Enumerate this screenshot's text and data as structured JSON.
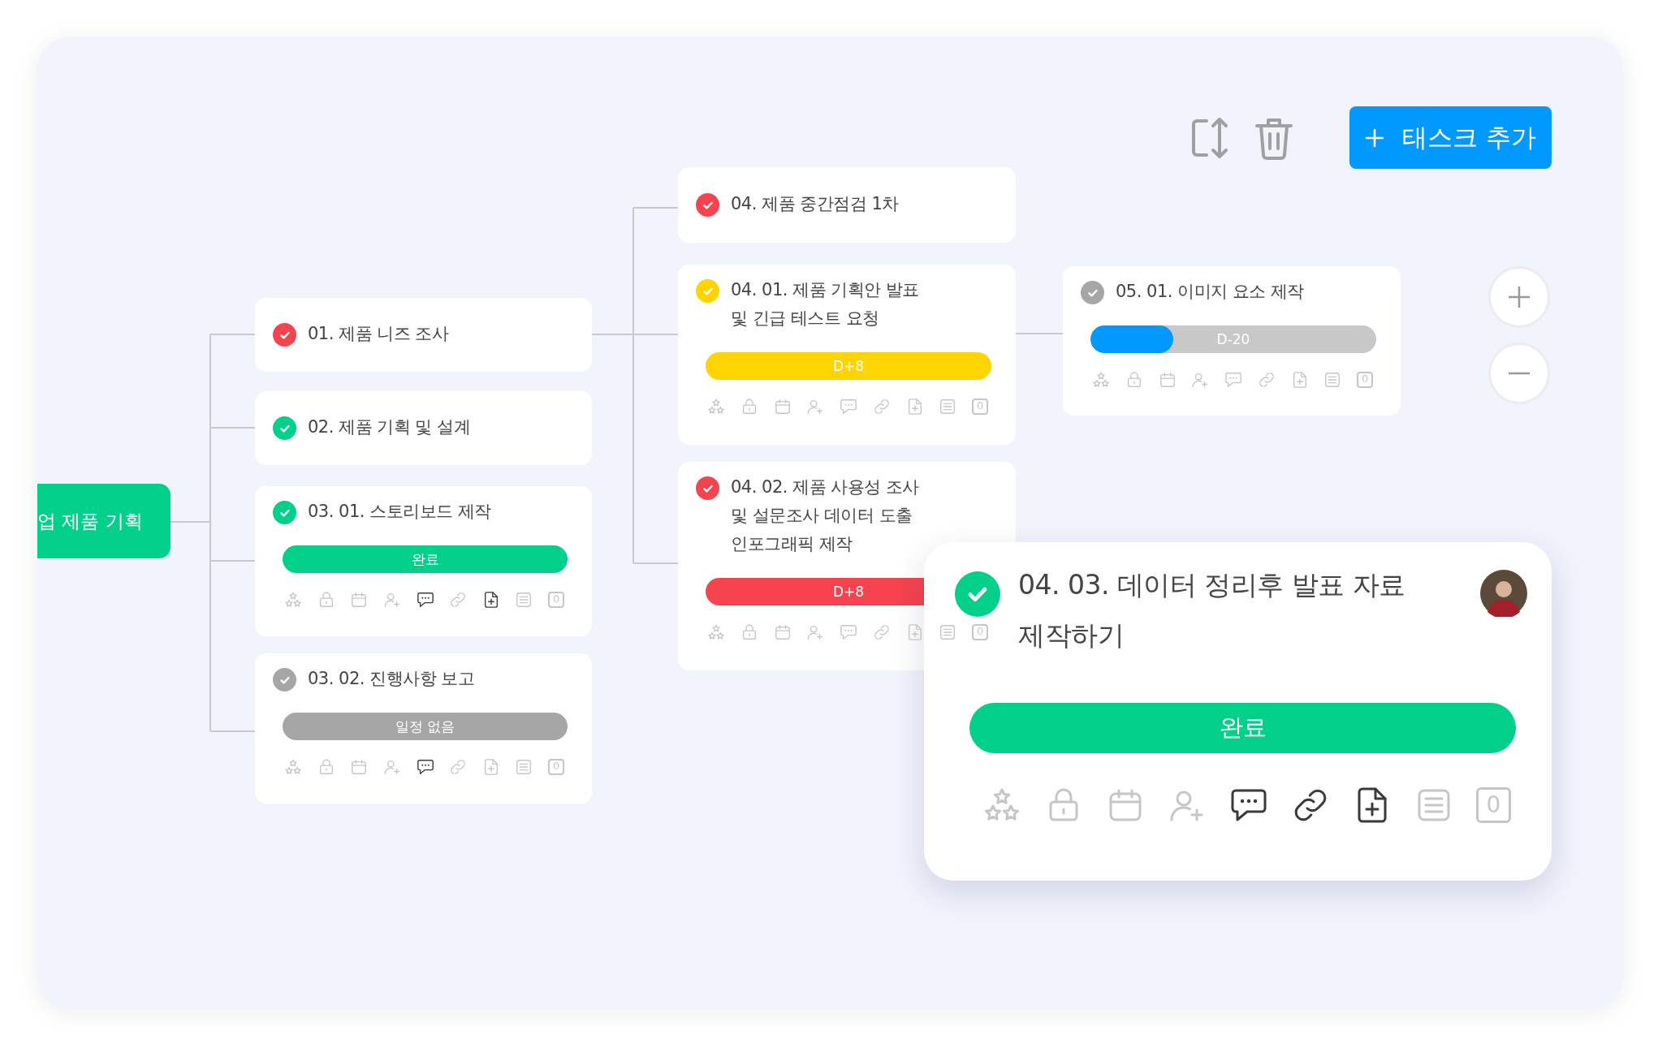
{
  "root": {
    "label": "업 제품 기획"
  },
  "toolbar": {
    "add_button": {
      "label": "태스크 추가"
    }
  },
  "tasks": [
    {
      "title": "01. 제품 니즈 조사",
      "color": "#f5434f"
    },
    {
      "title": "02. 제품 기획 및 설계",
      "color": "#00d08a"
    },
    {
      "title": "03. 01. 스토리보드 제작",
      "color": "#00d08a",
      "bar": {
        "label": "완료",
        "color": "#00d08a"
      },
      "tools": [
        {
          "kind": "stars",
          "active": false
        },
        {
          "kind": "lock",
          "active": false
        },
        {
          "kind": "calendar",
          "active": false
        },
        {
          "kind": "user-plus",
          "active": false
        },
        {
          "kind": "comment",
          "active": true
        },
        {
          "kind": "link",
          "active": false
        },
        {
          "kind": "file-plus",
          "active": true
        },
        {
          "kind": "list",
          "active": false
        },
        {
          "kind": "count",
          "active": false,
          "label": "0"
        }
      ]
    },
    {
      "title": "03. 02. 진행사항 보고",
      "color": "#a6a6a6",
      "bar": {
        "label": "일정 없음",
        "color": "#a6a6a6"
      },
      "tools": [
        {
          "kind": "stars",
          "active": false
        },
        {
          "kind": "lock",
          "active": false
        },
        {
          "kind": "calendar",
          "active": false
        },
        {
          "kind": "user-plus",
          "active": false
        },
        {
          "kind": "comment",
          "active": true
        },
        {
          "kind": "link",
          "active": false
        },
        {
          "kind": "file-plus",
          "active": false
        },
        {
          "kind": "list",
          "active": false
        },
        {
          "kind": "count",
          "active": false,
          "label": "0"
        }
      ]
    },
    {
      "title": "04. 제품 중간점검 1차",
      "color": "#f5434f"
    },
    {
      "title": "04. 01. 제품 기획안 발표\n및 긴급 테스트 요청",
      "color": "#ffd400",
      "bar": {
        "label": "D+8",
        "color": "#ffd400"
      },
      "tools": [
        {
          "kind": "stars",
          "active": false
        },
        {
          "kind": "lock",
          "active": false
        },
        {
          "kind": "calendar",
          "active": false
        },
        {
          "kind": "user-plus",
          "active": false
        },
        {
          "kind": "comment",
          "active": false
        },
        {
          "kind": "link",
          "active": false
        },
        {
          "kind": "file-plus",
          "active": false
        },
        {
          "kind": "list",
          "active": false
        },
        {
          "kind": "count",
          "active": false,
          "label": "0"
        }
      ]
    },
    {
      "title": "04. 02. 제품 사용성 조사\n및 설문조사 데이터 도출\n인포그래픽 제작",
      "color": "#f5434f",
      "bar": {
        "label": "D+8",
        "color": "#f5434f"
      },
      "tools": [
        {
          "kind": "stars",
          "active": false
        },
        {
          "kind": "lock",
          "active": false
        },
        {
          "kind": "calendar",
          "active": false
        },
        {
          "kind": "user-plus",
          "active": false
        },
        {
          "kind": "comment",
          "active": false
        },
        {
          "kind": "link",
          "active": false
        },
        {
          "kind": "file-plus",
          "active": false
        },
        {
          "kind": "list",
          "active": false
        },
        {
          "kind": "count",
          "active": false,
          "label": "0"
        }
      ]
    },
    {
      "title": "05. 01. 이미지 요소 제작",
      "color": "#a6a6a6",
      "bar": {
        "label": "D-20",
        "color": "#c8c8c8",
        "fill": {
          "color": "#0099ff",
          "level": 0.29
        }
      },
      "tools": [
        {
          "kind": "stars",
          "active": false
        },
        {
          "kind": "lock",
          "active": false
        },
        {
          "kind": "calendar",
          "active": false
        },
        {
          "kind": "user-plus",
          "active": false
        },
        {
          "kind": "comment",
          "active": false
        },
        {
          "kind": "link",
          "active": false
        },
        {
          "kind": "file-plus",
          "active": false
        },
        {
          "kind": "list",
          "active": false
        },
        {
          "kind": "count",
          "active": false,
          "label": "0"
        }
      ]
    }
  ],
  "detail_card": {
    "title": "04. 03. 데이터 정리후 발표 자료\n제작하기",
    "color": "#00d08a",
    "bar": {
      "label": "완료",
      "color": "#00d08a"
    },
    "tools": [
      {
        "kind": "stars",
        "active": false
      },
      {
        "kind": "lock",
        "active": false
      },
      {
        "kind": "calendar",
        "active": false
      },
      {
        "kind": "user-plus",
        "active": false
      },
      {
        "kind": "comment",
        "active": true
      },
      {
        "kind": "link",
        "active": true
      },
      {
        "kind": "file-plus",
        "active": true
      },
      {
        "kind": "list",
        "active": false
      },
      {
        "kind": "count",
        "active": false,
        "label": "0"
      }
    ]
  }
}
